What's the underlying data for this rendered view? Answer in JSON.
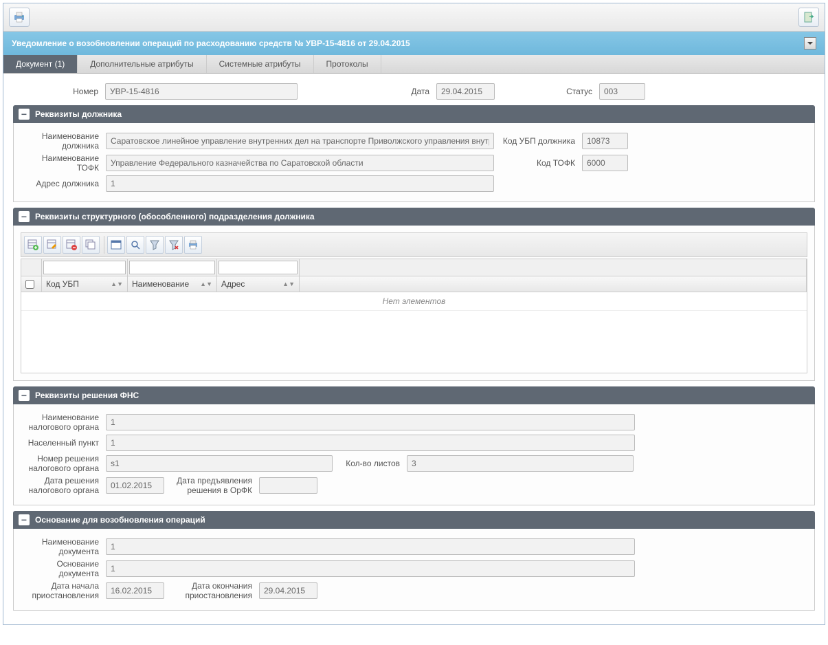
{
  "title_bar": "Уведомление о возобновлении операций по расходованию средств № УВР-15-4816 от 29.04.2015",
  "tabs": [
    "Документ (1)",
    "Дополнительные атрибуты",
    "Системные атрибуты",
    "Протоколы"
  ],
  "top_row": {
    "number_label": "Номер",
    "number_value": "УВР-15-4816",
    "date_label": "Дата",
    "date_value": "29.04.2015",
    "status_label": "Статус",
    "status_value": "003"
  },
  "section_debtor": {
    "title": "Реквизиты должника",
    "name_label": "Наименование должника",
    "name_value": "Саратовское линейное управление внутренних дел на транспорте Приволжского управления внутр",
    "ubp_code_label": "Код УБП должника",
    "ubp_code_value": "10873",
    "tofk_name_label": "Наименование ТОФК",
    "tofk_name_value": "Управление Федерального казначейства по Саратовской области",
    "tofk_code_label": "Код ТОФК",
    "tofk_code_value": "6000",
    "address_label": "Адрес должника",
    "address_value": "1"
  },
  "section_subdiv": {
    "title": "Реквизиты структурного (обособленного) подразделения должника",
    "grid_headers": {
      "ubp": "Код УБП",
      "name": "Наименование",
      "addr": "Адрес"
    },
    "empty_text": "Нет элементов"
  },
  "section_fns": {
    "title": "Реквизиты решения ФНС",
    "org_name_label": "Наименование налогового органа",
    "org_name_value": "1",
    "locality_label": "Населенный пункт",
    "locality_value": "1",
    "decision_num_label": "Номер решения налогового органа",
    "decision_num_value": "s1",
    "sheets_label": "Кол-во листов",
    "sheets_value": "3",
    "decision_date_label": "Дата решения налогового органа",
    "decision_date_value": "01.02.2015",
    "submit_date_label": "Дата предъявления решения в ОрФК",
    "submit_date_value": ""
  },
  "section_basis": {
    "title": "Основание для возобновления операций",
    "doc_name_label": "Наименование документа",
    "doc_name_value": "1",
    "doc_basis_label": "Основание документа",
    "doc_basis_value": "1",
    "start_date_label": "Дата начала приостановления",
    "start_date_value": "16.02.2015",
    "end_date_label": "Дата окончания приостановления",
    "end_date_value": "29.04.2015"
  }
}
